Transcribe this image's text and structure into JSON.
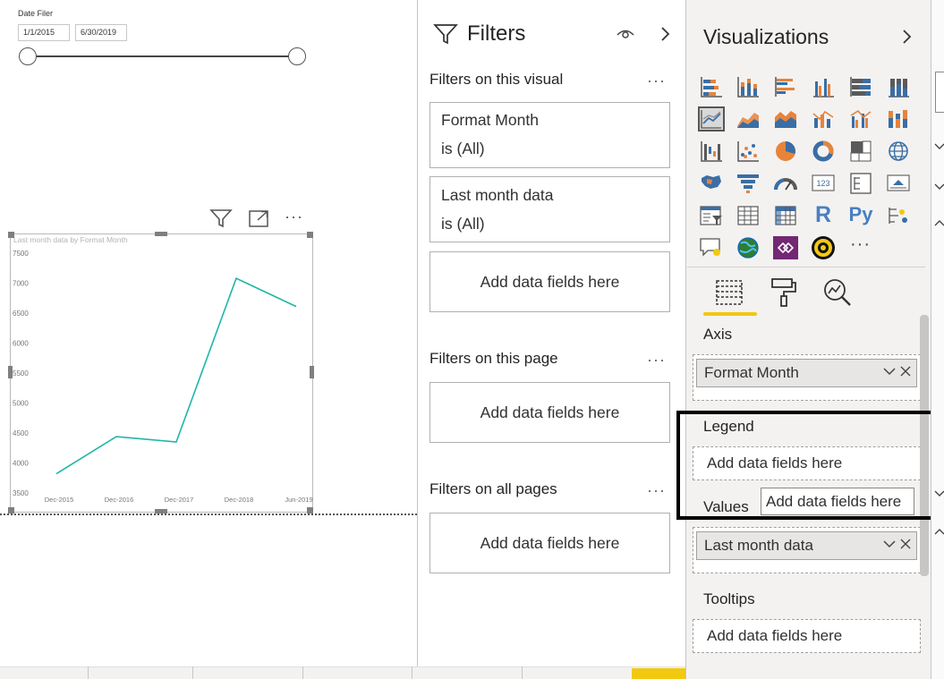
{
  "slicer": {
    "title": "Date Filer",
    "start_date": "1/1/2015",
    "end_date": "6/30/2019"
  },
  "visual_header": {
    "filter_icon": "filter-icon",
    "focus_icon": "focus-mode-icon",
    "more_label": "···"
  },
  "chart_data": {
    "type": "line",
    "title": "Last month data by Format Month",
    "categories": [
      "Dec-2015",
      "Dec-2016",
      "Dec-2017",
      "Dec-2018",
      "Jun-2019"
    ],
    "series": [
      {
        "values": [
          3820,
          4440,
          4350,
          7080,
          6610
        ],
        "color": "#1eb6a8"
      }
    ],
    "yticks": [
      "7500",
      "7000",
      "6500",
      "6000",
      "5500",
      "5000",
      "4500",
      "4000",
      "3500"
    ],
    "ylim": [
      3500,
      7500
    ],
    "grid": false,
    "legend": "none"
  },
  "filters": {
    "title": "Filters",
    "eye_icon": "eye-icon",
    "collapse_icon": "chevron-right-icon",
    "visual_section": "Filters on this visual",
    "page_section": "Filters on this page",
    "all_section": "Filters on all pages",
    "more": "···",
    "cards": [
      {
        "name": "Format Month",
        "state": "is (All)"
      },
      {
        "name": "Last month data",
        "state": "is (All)"
      }
    ],
    "drop_label": "Add data fields here"
  },
  "visualizations": {
    "title": "Visualizations",
    "collapse_icon": "chevron-right-icon",
    "more_visuals": "···",
    "axis_label": "Axis",
    "axis_field": "Format Month",
    "legend_label": "Legend",
    "legend_placeholder": "Add data fields here",
    "values_label": "Values",
    "values_field": "Last month data",
    "tooltips_label": "Tooltips",
    "tooltips_placeholder": "Add data fields here",
    "tooltip_text": "Add data fields here",
    "r_label": "R",
    "py_label": "Py",
    "card_label": "123"
  },
  "colors": {
    "accent": "#f2c811",
    "line": "#1eb6a8",
    "viz_orange": "#e8833a",
    "viz_blue": "#3a6ea5",
    "viz_gray": "#5a5a5a",
    "highlight": "#000000"
  }
}
